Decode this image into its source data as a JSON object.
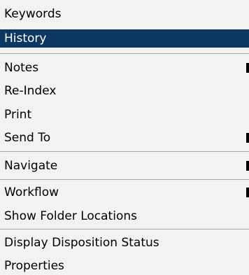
{
  "menu": {
    "items": [
      {
        "label": "Keywords"
      },
      {
        "label": "History"
      },
      {
        "label": "Notes"
      },
      {
        "label": "Re-Index"
      },
      {
        "label": "Print"
      },
      {
        "label": "Send To"
      },
      {
        "label": "Navigate"
      },
      {
        "label": "Workflow"
      },
      {
        "label": "Show Folder Locations"
      },
      {
        "label": "Display Disposition Status"
      },
      {
        "label": "Properties"
      }
    ],
    "selected_item": "History"
  },
  "colors": {
    "menu_background": "#f2f2f2",
    "highlight_background": "#0c3761",
    "highlight_text": "#ffffff",
    "separator": "#a8a8a8"
  }
}
